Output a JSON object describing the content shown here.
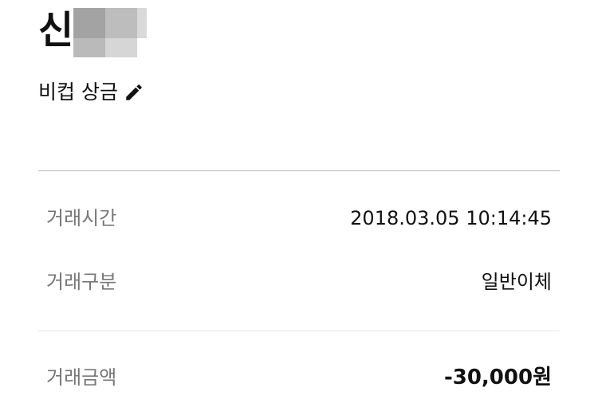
{
  "header": {
    "name_visible": "신",
    "name_redacted": true,
    "memo": "비컵 상금",
    "edit_icon": "pencil-icon"
  },
  "details": [
    {
      "label": "거래시간",
      "value": "2018.03.05 10:14:45"
    },
    {
      "label": "거래구분",
      "value": "일반이체"
    }
  ],
  "amount": {
    "label": "거래금액",
    "value": "-30,000원"
  },
  "colors": {
    "text": "#111111",
    "label": "#777777",
    "divider": "#b5b5b5",
    "divider_light": "#e6e6e6"
  }
}
